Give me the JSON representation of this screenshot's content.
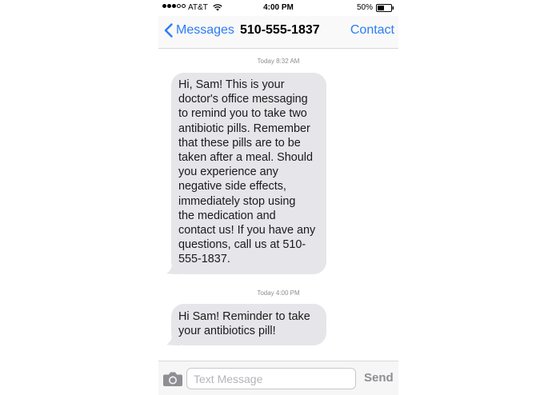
{
  "status_bar": {
    "signal": [
      "filled",
      "filled",
      "filled",
      "empty",
      "empty"
    ],
    "carrier": "AT&T",
    "wifi_icon": "wifi-icon",
    "time": "4:00 PM",
    "battery_percent": "50%",
    "battery_level": 0.5,
    "battery_icon": "battery-icon"
  },
  "nav": {
    "back_label": "Messages",
    "back_icon": "chevron-left-icon",
    "title": "510-555-1837",
    "contact_label": "Contact"
  },
  "messages": [
    {
      "timestamp": "Today 8:32 AM",
      "lines": [
        "Hi, Sam! This is your",
        "doctor's office messaging",
        "to remind you to take two",
        "antibiotic pills. Remember",
        "that these pills are to be",
        "taken after a meal. Should",
        "you experience any",
        "negative side effects,",
        "immediately stop using",
        "the medication and",
        "contact us! If you have any",
        "questions, call us at 510-",
        "555-1837."
      ]
    },
    {
      "timestamp": "Today 4:00 PM",
      "lines": [
        "Hi Sam! Reminder to take",
        "your antibiotics pill!"
      ]
    }
  ],
  "composer": {
    "camera_icon": "camera-icon",
    "placeholder": "Text Message",
    "value": "",
    "send_label": "Send"
  },
  "colors": {
    "accent": "#2b7cf6",
    "bubble_incoming": "#e5e5ea",
    "timestamp": "#8e8e93"
  }
}
